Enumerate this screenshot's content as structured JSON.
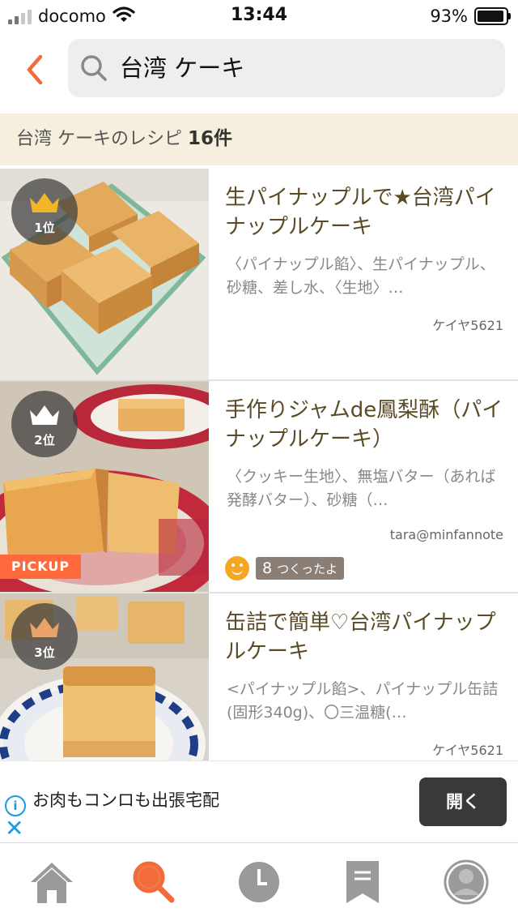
{
  "status": {
    "carrier": "docomo",
    "time": "13:44",
    "battery": "93%",
    "battery_level": 0.93
  },
  "search": {
    "query": "台湾 ケーキ"
  },
  "result": {
    "label": "台湾 ケーキのレシピ",
    "count": "16件"
  },
  "recipes": [
    {
      "rank": "1位",
      "rank_color": "#f5b52a",
      "title": "生パイナップルで★台湾パイナップルケーキ",
      "ingredients": "〈パイナップル餡〉、生パイナップル、砂糖、差し水、〈生地〉…",
      "author": "ケイヤ5621"
    },
    {
      "rank": "2位",
      "rank_color": "#ffffff",
      "title": "手作りジャムde鳳梨酥（パイナップルケーキ）",
      "ingredients": "〈クッキー生地〉、無塩バター（あれば発酵バター）、砂糖（…",
      "author": "tara@minfannote",
      "badge": "PICKUP",
      "tsukuretayo_count": "8",
      "tsukuretayo_label": "つくったよ"
    },
    {
      "rank": "3位",
      "rank_color": "#e9a36a",
      "title": "缶詰で簡単♡台湾パイナップルケーキ",
      "ingredients": "<パイナップル餡>、パイナップル缶詰(固形340g)、〇三温糖(…",
      "author": "ケイヤ5621"
    }
  ],
  "ad": {
    "text": "お肉もコンロも出張宅配",
    "button": "開く"
  },
  "tabs": [
    {
      "icon": "home-icon",
      "active": false
    },
    {
      "icon": "search-icon",
      "active": true
    },
    {
      "icon": "history-icon",
      "active": false
    },
    {
      "icon": "bookmark-icon",
      "active": false
    },
    {
      "icon": "profile-icon",
      "active": false
    }
  ],
  "colors": {
    "accent": "#f26b3a",
    "result_bar": "#f6efde",
    "title_text": "#5a4a26",
    "tab_inactive": "#9a9a9a"
  }
}
